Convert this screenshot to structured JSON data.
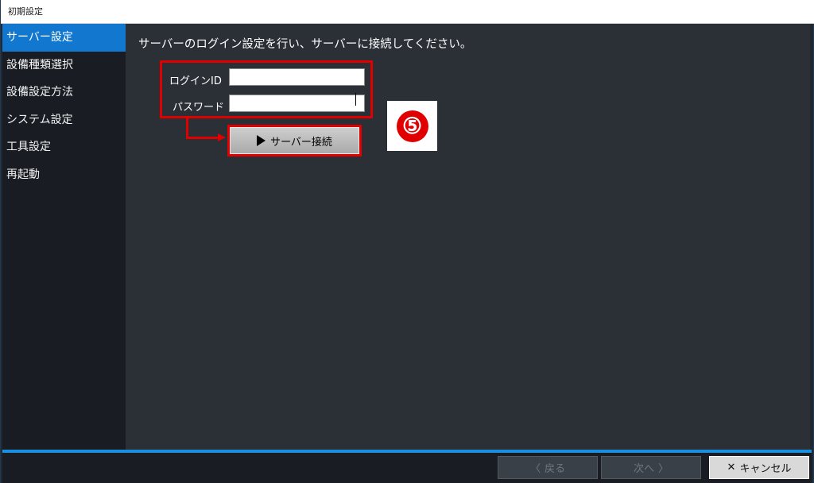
{
  "window": {
    "title": "初期設定"
  },
  "sidebar": {
    "items": [
      {
        "label": "サーバー設定",
        "active": true
      },
      {
        "label": "設備種類選択",
        "active": false
      },
      {
        "label": "設備設定方法",
        "active": false
      },
      {
        "label": "システム設定",
        "active": false
      },
      {
        "label": "工具設定",
        "active": false
      },
      {
        "label": "再起動",
        "active": false
      }
    ]
  },
  "main": {
    "instruction": "サーバーのログイン設定を行い、サーバーに接続してください。",
    "login_id": {
      "label": "ログインID",
      "value": "",
      "placeholder": ""
    },
    "password": {
      "label": "パスワード",
      "value": "",
      "placeholder": ""
    },
    "connect_button": {
      "label": "サーバー接続",
      "icon": "play-icon"
    },
    "step_badge": "⑤"
  },
  "footer": {
    "back": {
      "label": "戻る",
      "icon": "chevron-left-icon",
      "glyph": "〈",
      "enabled": false
    },
    "next": {
      "label": "次へ",
      "icon": "chevron-right-icon",
      "glyph": "〉",
      "enabled": false
    },
    "cancel": {
      "label": "キャンセル",
      "icon": "close-icon",
      "glyph": "✕",
      "enabled": true
    }
  },
  "colors": {
    "accent": "#1177cf",
    "highlight": "#e00000",
    "background": "#2b2f36",
    "sidebar": "#191d23"
  }
}
